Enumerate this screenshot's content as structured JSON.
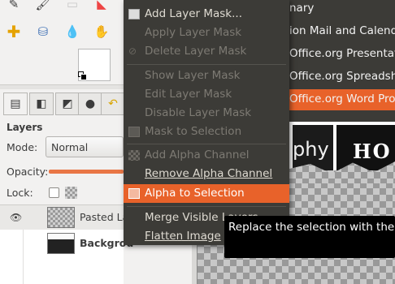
{
  "toolbox": {
    "tools": [
      "pencil-icon",
      "brush-icon",
      "eraser-icon",
      "heal-icon",
      "clone-icon",
      "blur-icon",
      "smudge-icon"
    ]
  },
  "dock": {
    "tabs": [
      "layers-tab",
      "channels-tab",
      "paths-tab",
      "colormap-tab",
      "undo-tab"
    ],
    "title": "Layers",
    "mode_label": "Mode:",
    "mode_value": "Normal",
    "opacity_label": "Opacity:",
    "opacity_fraction": 1.0,
    "lock_label": "Lock:",
    "layers": [
      {
        "name": "Pasted La",
        "visible": true,
        "selected": true
      },
      {
        "name": "Backgrou",
        "visible": false,
        "selected": false
      }
    ]
  },
  "window_menu": {
    "items": [
      "nary",
      "ion Mail and Calend",
      "Office.org Presentat",
      "Office.org Spreadsh",
      "Office.org Word Pro"
    ],
    "selected_index": 4
  },
  "photo": {
    "left_text": "phy",
    "right_text": "HO"
  },
  "context_menu": {
    "items": [
      {
        "label": "Add Layer Mask...",
        "enabled": true
      },
      {
        "label": "Apply Layer Mask",
        "enabled": false
      },
      {
        "label": "Delete Layer Mask",
        "enabled": false
      },
      {
        "label": "Show Layer Mask",
        "enabled": false
      },
      {
        "label": "Edit Layer Mask",
        "enabled": false
      },
      {
        "label": "Disable Layer Mask",
        "enabled": false
      },
      {
        "label": "Mask to Selection",
        "enabled": false
      },
      {
        "label": "Add Alpha Channel",
        "enabled": false
      },
      {
        "label": "Remove Alpha Channel",
        "enabled": true
      },
      {
        "label": "Alpha to Selection",
        "enabled": true,
        "highlighted": true
      },
      {
        "label": "Merge Visible Layers...",
        "enabled": true
      },
      {
        "label": "Flatten Image",
        "enabled": true
      }
    ]
  },
  "tooltip": {
    "text": "Replace the selection with the l"
  },
  "colors": {
    "accent": "#e8622a",
    "menu_bg": "#3c3b37"
  }
}
